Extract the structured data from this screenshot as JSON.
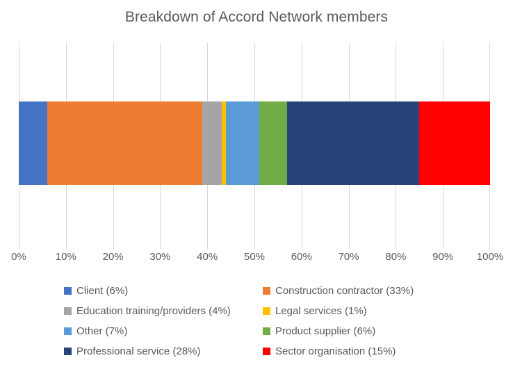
{
  "chart_data": {
    "type": "bar",
    "orientation": "horizontal",
    "stacked": true,
    "title": "Breakdown of Accord Network members",
    "xlabel": "",
    "ylabel": "",
    "xlim": [
      0,
      100
    ],
    "grid": true,
    "grid_axis": "x",
    "legend_position": "bottom",
    "categories": [
      "Accord Network members"
    ],
    "tick_labels": [
      "0%",
      "10%",
      "20%",
      "30%",
      "40%",
      "50%",
      "60%",
      "70%",
      "80%",
      "90%",
      "100%"
    ],
    "tick_values": [
      0,
      10,
      20,
      30,
      40,
      50,
      60,
      70,
      80,
      90,
      100
    ],
    "series": [
      {
        "name": "Client",
        "label": "Client (6%)",
        "value": 6,
        "color": "#4472C4",
        "start": 0,
        "end": 6
      },
      {
        "name": "Construction contractor",
        "label": "Construction contractor (33%)",
        "value": 33,
        "color": "#ED7D31",
        "start": 6,
        "end": 39
      },
      {
        "name": "Education training/providers",
        "label": "Education training/providers (4%)",
        "value": 4,
        "color": "#A5A5A5",
        "start": 39,
        "end": 43
      },
      {
        "name": "Legal services",
        "label": "Legal services (1%)",
        "value": 1,
        "color": "#FFC000",
        "start": 43,
        "end": 44
      },
      {
        "name": "Other",
        "label": "Other (7%)",
        "value": 7,
        "color": "#5B9BD5",
        "start": 44,
        "end": 51
      },
      {
        "name": "Product supplier",
        "label": "Product supplier (6%)",
        "value": 6,
        "color": "#70AD47",
        "start": 51,
        "end": 57
      },
      {
        "name": "Professional service",
        "label": "Professional service (28%)",
        "value": 28,
        "color": "#264478",
        "start": 57,
        "end": 85
      },
      {
        "name": "Sector organisation",
        "label": "Sector organisation (15%)",
        "value": 15,
        "color": "#FF0000",
        "start": 85,
        "end": 100
      }
    ]
  },
  "legend": {
    "items": [
      {
        "label": "Client (6%)",
        "color": "#4472C4"
      },
      {
        "label": "Construction contractor (33%)",
        "color": "#ED7D31"
      },
      {
        "label": "Education training/providers (4%)",
        "color": "#A5A5A5"
      },
      {
        "label": "Legal services (1%)",
        "color": "#FFC000"
      },
      {
        "label": "Other (7%)",
        "color": "#5B9BD5"
      },
      {
        "label": "Product supplier (6%)",
        "color": "#70AD47"
      },
      {
        "label": "Professional service (28%)",
        "color": "#264478"
      },
      {
        "label": "Sector organisation (15%)",
        "color": "#FF0000"
      }
    ]
  },
  "style": {
    "text_color": "#595959",
    "gridline_color": "#D9D9D9",
    "background": "#FFFFFF"
  }
}
